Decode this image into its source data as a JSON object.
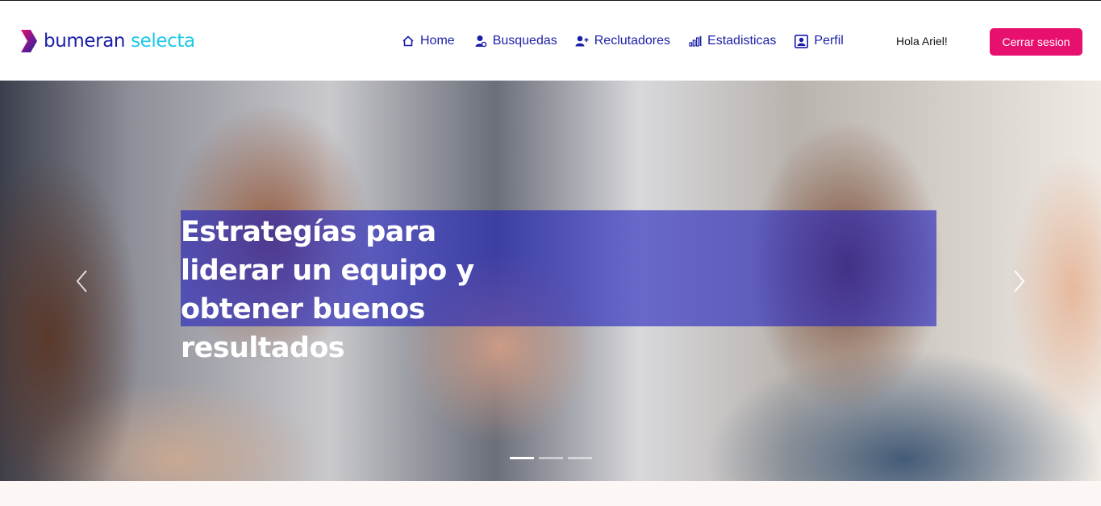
{
  "brand": {
    "name_part1": "bumeran",
    "name_part2": "selecta",
    "colors": {
      "primary": "#1a1fa8",
      "accent": "#1ec8e8",
      "pink": "#e8106f"
    }
  },
  "nav": {
    "items": [
      {
        "label": "Home",
        "icon": "home-icon"
      },
      {
        "label": "Busquedas",
        "icon": "user-search-icon"
      },
      {
        "label": "Reclutadores",
        "icon": "user-plus-icon"
      },
      {
        "label": "Estadisticas",
        "icon": "bar-chart-icon"
      },
      {
        "label": "Perfil",
        "icon": "profile-card-icon"
      }
    ]
  },
  "user": {
    "greeting": "Hola Ariel!",
    "logout_label": "Cerrar sesion"
  },
  "hero": {
    "title": "Estrategías para liderar un equipo y obtener buenos resultados",
    "slides_count": 3,
    "active_slide": 1
  }
}
